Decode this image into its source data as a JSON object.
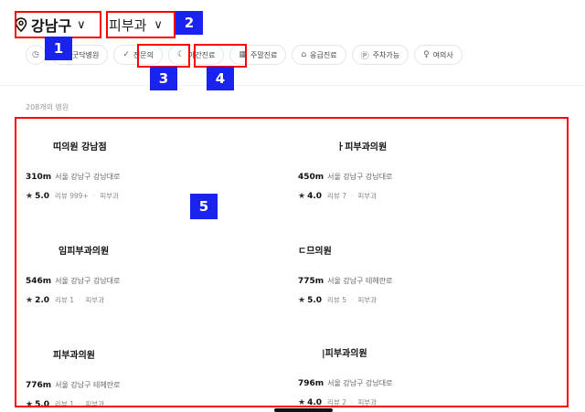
{
  "header": {
    "location": "강남구",
    "department": "피부과",
    "location_chevron": "∨",
    "department_chevron": "∨"
  },
  "filters": [
    {
      "label": "",
      "icon": "clock-icon"
    },
    {
      "label": "굿닥병원",
      "icon": "goodoc-icon"
    },
    {
      "label": "전문의",
      "icon": "check-circle-icon"
    },
    {
      "label": "야간진료",
      "icon": "moon-icon"
    },
    {
      "label": "주말진료",
      "icon": "calendar-icon"
    },
    {
      "label": "응급진료",
      "icon": "siren-icon"
    },
    {
      "label": "주차가능",
      "icon": "parking-icon"
    },
    {
      "label": "여의사",
      "icon": "female-doctor-icon"
    }
  ],
  "results": {
    "count_text": "208개의 병원"
  },
  "hospitals": [
    {
      "name": "띠의원 강남점",
      "distance": "310m",
      "address": "서울 강남구 강남대로",
      "rating": "5.0",
      "reviews": "리뷰 999+",
      "dept": "피부과"
    },
    {
      "name": "ㅏ피부과의원",
      "distance": "450m",
      "address": "서울 강남구 강남대로",
      "rating": "4.0",
      "reviews": "리뷰 7",
      "dept": "피부과"
    },
    {
      "name": "임피부과의원",
      "distance": "546m",
      "address": "서울 강남구 강남대로",
      "rating": "2.0",
      "reviews": "리뷰 1",
      "dept": "피부과"
    },
    {
      "name": "ㄷ므의원",
      "distance": "775m",
      "address": "서울 강남구 테헤란로",
      "rating": "5.0",
      "reviews": "리뷰 5",
      "dept": "피부과"
    },
    {
      "name": "피부과의원",
      "distance": "776m",
      "address": "서울 강남구 테헤란로",
      "rating": "5.0",
      "reviews": "리뷰 1",
      "dept": "피부과"
    },
    {
      "name": "|피부과의원",
      "distance": "796m",
      "address": "서울 강남구 강남대로",
      "rating": "4.0",
      "reviews": "리뷰 2",
      "dept": "피부과"
    }
  ],
  "annotations": [
    "1",
    "2",
    "3",
    "4",
    "5"
  ],
  "colors": {
    "highlight": "#ff0000",
    "badge": "#1a22ee",
    "goodoc": "#3d6ae8"
  }
}
